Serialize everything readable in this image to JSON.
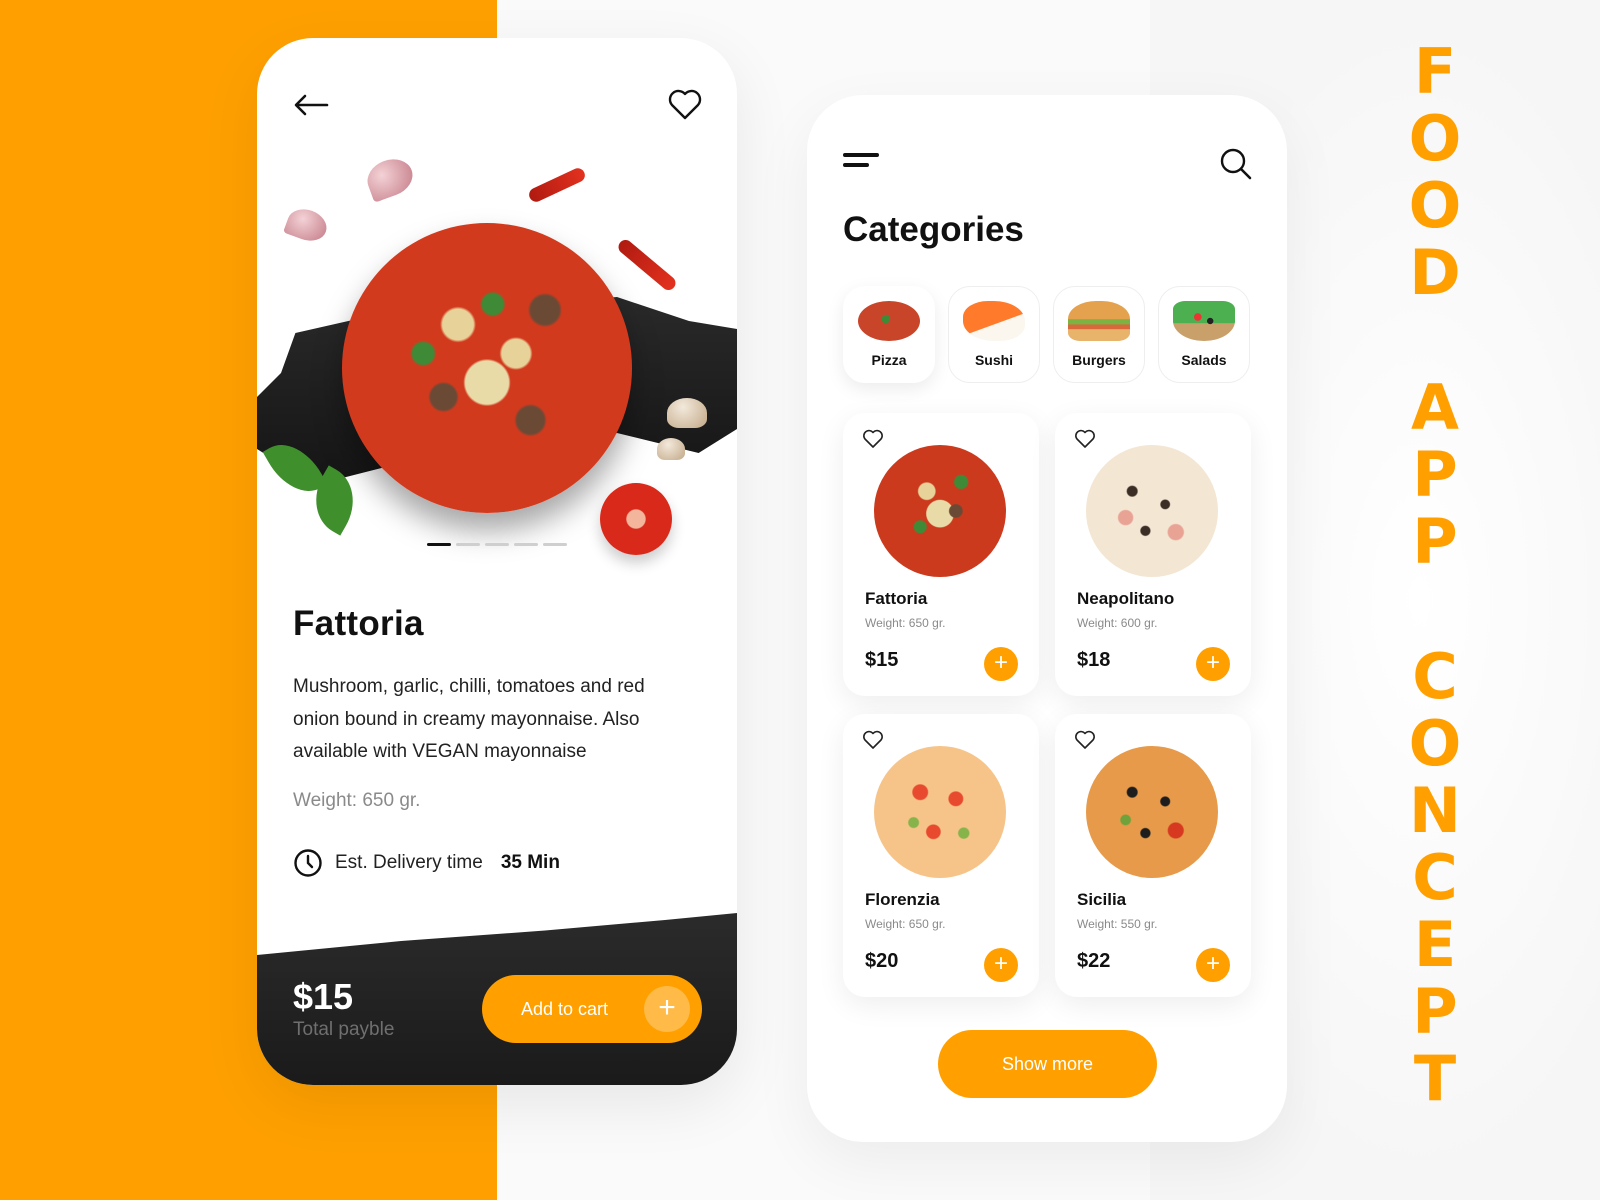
{
  "brand_color": "#ffa000",
  "vertical_title": {
    "words": [
      "FOOD",
      "APP",
      "CONCEPT"
    ]
  },
  "detail_screen": {
    "back_icon": "arrow-left-icon",
    "favorite_icon": "heart-outline-icon",
    "carousel": {
      "pages": 5,
      "active_index": 0
    },
    "title": "Fattoria",
    "description": "Mushroom, garlic, chilli, tomatoes and red onion bound in creamy mayonnaise. Also available with VEGAN mayonnaise",
    "weight": "Weight: 650 gr.",
    "delivery": {
      "icon": "clock-icon",
      "label": "Est. Delivery time",
      "value": "35 Min"
    },
    "footer": {
      "price": "$15",
      "price_label": "Total payble",
      "add_to_cart_label": "Add to cart",
      "add_icon": "+"
    }
  },
  "categories_screen": {
    "menu_icon": "menu-icon",
    "search_icon": "search-icon",
    "title": "Categories",
    "categories": [
      {
        "label": "Pizza",
        "icon": "pizza-image",
        "active": true
      },
      {
        "label": "Sushi",
        "icon": "sushi-image",
        "active": false
      },
      {
        "label": "Burgers",
        "icon": "burger-image",
        "active": false
      },
      {
        "label": "Salads",
        "icon": "salad-image",
        "active": false
      }
    ],
    "products": [
      {
        "name": "Fattoria",
        "weight": "Weight: 650 gr.",
        "price": "$15",
        "add_icon": "+"
      },
      {
        "name": "Neapolitano",
        "weight": "Weight: 600 gr.",
        "price": "$18",
        "add_icon": "+"
      },
      {
        "name": "Florenzia",
        "weight": "Weight: 650 gr.",
        "price": "$20",
        "add_icon": "+"
      },
      {
        "name": "Sicilia",
        "weight": "Weight: 550 gr.",
        "price": "$22",
        "add_icon": "+"
      }
    ],
    "show_more_label": "Show more"
  }
}
